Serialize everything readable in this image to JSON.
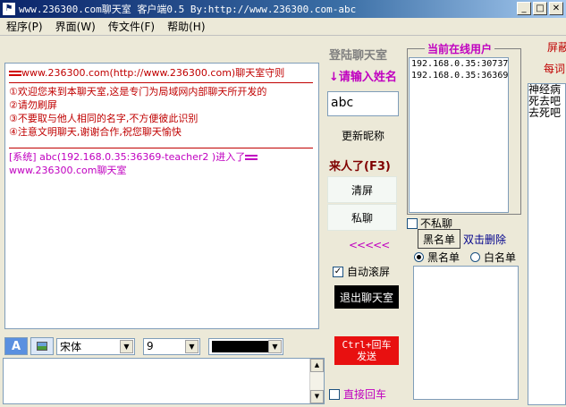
{
  "window": {
    "title": "www.236300.com聊天室 客户端0.5  By:http://www.236300.com-abc"
  },
  "menu": {
    "items": [
      "程序(P)",
      "界面(W)",
      "传文件(F)",
      "帮助(H)"
    ]
  },
  "chat": {
    "rules_title": "www.236300.com(http://www.236300.com)聊天室守则",
    "rules": [
      "①欢迎您来到本聊天室,这是专门为局域网内部聊天所开发的",
      "②请勿刷屏",
      "③不要取与他人相同的名字,不方便彼此识别",
      "④注意文明聊天,谢谢合作,祝您聊天愉快"
    ],
    "system_msg_line1": "[系统] abc(192.168.0.35:36369-teacher2 )进入了",
    "system_msg_line2": "www.236300.com聊天室"
  },
  "format_bar": {
    "font_name": "宋体",
    "font_size": "9",
    "text_color": "#000000"
  },
  "side": {
    "login_title": "登陆聊天室",
    "enter_name": "↓请输入姓名",
    "name_value": "abc",
    "rename_label": "更新昵称",
    "arrival_label": "来人了(F3)",
    "clear_label": "清屏",
    "private_label": "私聊",
    "scroll_left_label": "<<<<<",
    "autoscroll_label": "自动滚屏",
    "exit_label": "退出聊天室",
    "send_line1": "Ctrl+回车",
    "send_line2": "发送",
    "direct_enter_label": "直接回车"
  },
  "online": {
    "title": "当前在线用户",
    "users": [
      "192.168.0.35:30737",
      "192.168.0.35:36369"
    ],
    "no_private_label": "不私聊",
    "blacklist_btn": "黑名单",
    "dbl_delete": "双击删除",
    "radio_black": "黑名单",
    "radio_white": "白名单"
  },
  "right": {
    "label1": "屏蔽",
    "label2": "每词",
    "words": [
      "神经病",
      "死去吧",
      "去死吧"
    ]
  }
}
